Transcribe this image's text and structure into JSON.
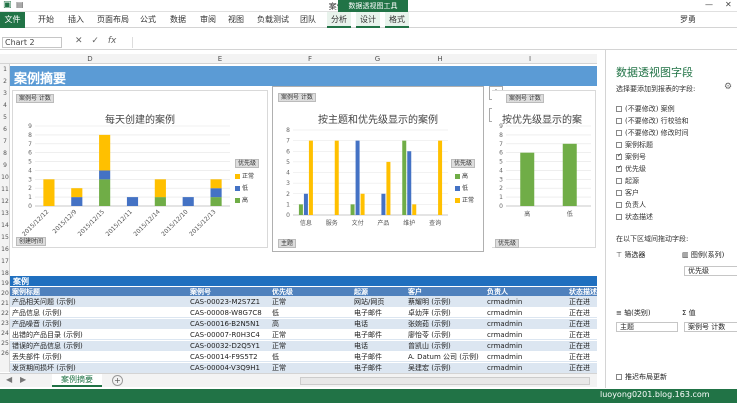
{
  "window": {
    "title": "案例摘要.xlsx - Excel",
    "context_tab_group": "数据透视图工具",
    "user": "罗勇"
  },
  "ribbon_tabs": [
    "文件",
    "开始",
    "插入",
    "页面布局",
    "公式",
    "数据",
    "审阅",
    "视图",
    "负载测试",
    "团队",
    "分析",
    "设计",
    "格式"
  ],
  "formula_bar": {
    "name_box": "Chart 2",
    "fx": "fx"
  },
  "columns": [
    "D",
    "E",
    "F",
    "G",
    "H",
    "I"
  ],
  "rows": [
    "1",
    "2",
    "3",
    "4",
    "5",
    "6",
    "7",
    "8",
    "9",
    "10",
    "11",
    "12",
    "13",
    "14",
    "15",
    "16",
    "17",
    "18",
    "19",
    "20",
    "21",
    "22",
    "23",
    "24",
    "25",
    "26",
    "27"
  ],
  "banner_title": "案例摘要",
  "charts": {
    "c1": {
      "value_button": "案例号 计数",
      "title": "每天创建的案例",
      "axis_button": "创建时间",
      "legend_button": "优先级",
      "legend": [
        "正常",
        "低",
        "高"
      ]
    },
    "c2": {
      "value_button": "案例号 计数",
      "title": "按主题和优先级显示的案例",
      "axis_button": "主题",
      "legend_button": "优先级",
      "legend": [
        "高",
        "低",
        "正常"
      ]
    },
    "c3": {
      "value_button": "案例号 计数",
      "title": "按优先级显示的案",
      "axis_button": "优先级"
    }
  },
  "chart_data": [
    {
      "type": "bar",
      "title": "每天创建的案例",
      "categories": [
        "2015/12/12",
        "2015/12/9",
        "2015/12/15",
        "2015/12/11",
        "2015/12/14",
        "2015/12/10",
        "2015/12/13"
      ],
      "series": [
        {
          "name": "高",
          "values": [
            0,
            0,
            3,
            0,
            1,
            0,
            1
          ]
        },
        {
          "name": "低",
          "values": [
            0,
            1,
            1,
            1,
            0,
            1,
            1
          ]
        },
        {
          "name": "正常",
          "values": [
            3,
            1,
            4,
            0,
            2,
            0,
            1
          ]
        }
      ],
      "ylim": [
        0,
        9
      ],
      "yticks": [
        "0",
        "1",
        "2",
        "3",
        "4",
        "5",
        "6",
        "7",
        "8",
        "9"
      ],
      "stacked": true,
      "legend": "right"
    },
    {
      "type": "bar",
      "title": "按主题和优先级显示的案例",
      "categories": [
        "信息",
        "服务",
        "文付",
        "产品",
        "维护",
        "查询"
      ],
      "series": [
        {
          "name": "高",
          "values": [
            1,
            0,
            1,
            0,
            7,
            0
          ]
        },
        {
          "name": "低",
          "values": [
            2,
            0,
            7,
            2,
            6,
            0
          ]
        },
        {
          "name": "正常",
          "values": [
            7,
            7,
            2,
            5,
            1,
            7
          ]
        }
      ],
      "ylim": [
        0,
        8
      ],
      "yticks": [
        "0",
        "1",
        "2",
        "3",
        "4",
        "5",
        "6",
        "7",
        "8"
      ],
      "legend": "right"
    },
    {
      "type": "bar",
      "title": "按优先级显示的案",
      "categories": [
        "高",
        "低"
      ],
      "values": [
        6,
        7
      ],
      "ylim": [
        0,
        9
      ],
      "yticks": [
        "0",
        "1",
        "2",
        "3",
        "4",
        "5",
        "6",
        "7",
        "8",
        "9"
      ]
    }
  ],
  "colors": {
    "high": "#70ad47",
    "low": "#4472c4",
    "normal": "#ffc000",
    "excel_green": "#217346",
    "banner": "#5b9bd5",
    "table_header": "#4f81bd"
  },
  "table": {
    "title": "案例",
    "headers": [
      "案例标题",
      "案例号",
      "优先级",
      "起源",
      "客户",
      "负责人",
      "状态描述"
    ],
    "rows": [
      [
        "产品相关问题 (示例)",
        "CAS-00023-M2S7Z1",
        "正常",
        "网站/网页",
        "蔡耀明 (示例)",
        "crmadmin",
        "正在进"
      ],
      [
        "产品信息 (示例)",
        "CAS-00008-W8G7C8",
        "低",
        "电子邮件",
        "卓幼萍 (示例)",
        "crmadmin",
        "正在进"
      ],
      [
        "产品噪音 (示例)",
        "CAS-00016-B2N5N1",
        "高",
        "电话",
        "张婉茹 (示例)",
        "crmadmin",
        "正在进"
      ],
      [
        "出错的产品目录 (示例)",
        "CAS-00007-R0H3C4",
        "正常",
        "电子邮件",
        "廖怡苓 (示例)",
        "crmadmin",
        "正在进"
      ],
      [
        "错误的产品信息 (示例)",
        "CAS-00032-D2Q5Y1",
        "正常",
        "电话",
        "曾凯山 (示例)",
        "crmadmin",
        "正在进"
      ],
      [
        "丢失部件 (示例)",
        "CAS-00014-F9S5T2",
        "低",
        "电子邮件",
        "A. Datum 公司 (示例)",
        "crmadmin",
        "正在进"
      ],
      [
        "发货期间损坏 (示例)",
        "CAS-00004-V3Q9H1",
        "正常",
        "电子邮件",
        "吴建宏 (示例)",
        "crmadmin",
        "正在进"
      ]
    ]
  },
  "sheet_tab": "案例摘要",
  "pivot_pane": {
    "title": "数据透视图字段",
    "subtitle": "选择要添加到报表的字段:",
    "fields": [
      {
        "label": "(不要修改) 案例",
        "checked": false
      },
      {
        "label": "(不要修改) 行校验和",
        "checked": false
      },
      {
        "label": "(不要修改) 修改时间",
        "checked": false
      },
      {
        "label": "案例标题",
        "checked": false
      },
      {
        "label": "案例号",
        "checked": true
      },
      {
        "label": "优先级",
        "checked": true
      },
      {
        "label": "起源",
        "checked": false
      },
      {
        "label": "客户",
        "checked": false
      },
      {
        "label": "负责人",
        "checked": false
      },
      {
        "label": "状态描述",
        "checked": false
      }
    ],
    "drag_label": "在以下区域间拖动字段:",
    "filter_label": "筛选器",
    "legend_label": "图例(系列)",
    "legend_value": "优先级",
    "axis_label": "轴(类别)",
    "axis_value": "主题",
    "values_label": "值",
    "values_value": "案例号 计数",
    "defer_label": "推迟布局更新"
  },
  "watermark": "luoyong0201.blog.163.com"
}
